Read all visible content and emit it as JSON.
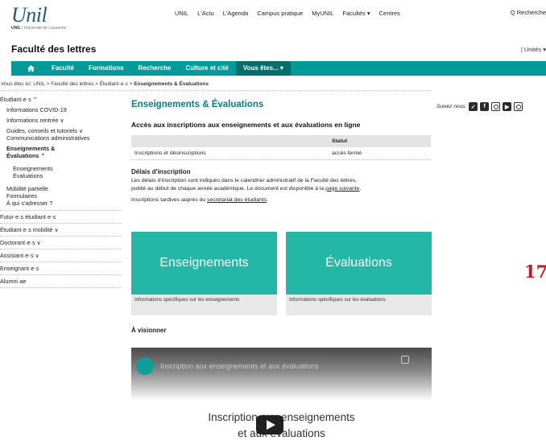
{
  "header": {
    "logo_word": "Unil",
    "logo_tag_bold": "UNIL",
    "logo_tag": "| Université de Lausanne",
    "topnav": [
      "UNIL",
      "L'Actu",
      "L'Agenda",
      "Campus pratique",
      "MyUNIL",
      "Facultés ▾",
      "Centres"
    ],
    "search_label": "Q Recherche",
    "faculty_title": "Faculté des lettres",
    "units_label": "| Unités ▾"
  },
  "mainnav": {
    "home_icon": "home-icon",
    "items": [
      "Faculté",
      "Formations",
      "Recherche",
      "Culture et cité",
      "Vous êtes... ▾"
    ]
  },
  "breadcrumb": {
    "prefix": "Vous êtes ici:",
    "path": "UNIL > Faculté des lettres > Étudiant·e·s >",
    "current": "Enseignements & Évaluations"
  },
  "sidebar": {
    "items": [
      "Étudiant·e·s ⌃",
      "Informations COVID-19",
      "Informations rentrée ∨",
      "Guides, conseils et tutoriels ∨",
      "Communications administratives",
      "Enseignements & Évaluations ⌃",
      "Enseignements",
      "Évaluations",
      "Mobilité partielle",
      "Formulaires",
      "À qui s'adresser ?",
      "Futur·e·s étudiant·e·s",
      "Étudiant·e·s mobilité ∨",
      "Doctorant·e·s ∨",
      "Assistant·e·s ∨",
      "Enseignant·e·s",
      "Alumni·ae"
    ]
  },
  "main": {
    "title": "Enseignements & Évaluations",
    "section_title": "Accès aux inscriptions aux enseignements et aux évaluations en ligne",
    "table": {
      "header": [
        "",
        "Statut"
      ],
      "rows": [
        [
          "Inscriptions et désinscriptions",
          "accès fermé"
        ]
      ]
    },
    "delais_title": "Délais d'inscription",
    "delais_text_1": "Les délais d'inscription sont indiqués dans le calendrier administratif de la Faculté des lettres,",
    "delais_text_2a": "publié au début de chaque année académique. Le document est disponible à la",
    "delais_link": "page suivante",
    "delais_text_3a": "Inscriptions tardives auprès du",
    "delais_link2": "secrétariat des étudiants",
    "cards": [
      {
        "label": "Enseignements",
        "desc": "Informations spécifiques sur les enseignements"
      },
      {
        "label": "Évaluations",
        "desc": "Informations spécifiques sur les évaluations"
      }
    ],
    "watch_title": "À visionner",
    "video": {
      "title": "Inscription aux enseignements et aux évaluations",
      "big_line1": "Inscription aux enseignements",
      "big_line2": "et aux évaluations"
    }
  },
  "follow": {
    "label": "Suivez nous:",
    "icons": [
      "twitter-icon",
      "facebook-icon",
      "instagram-icon",
      "youtube-icon",
      "other-social-icon"
    ]
  },
  "overlay_number": "17",
  "colors": {
    "accent": "#009b97",
    "title": "#00827e",
    "tile": "#23b8a6",
    "overlay": "#c21a1a"
  }
}
